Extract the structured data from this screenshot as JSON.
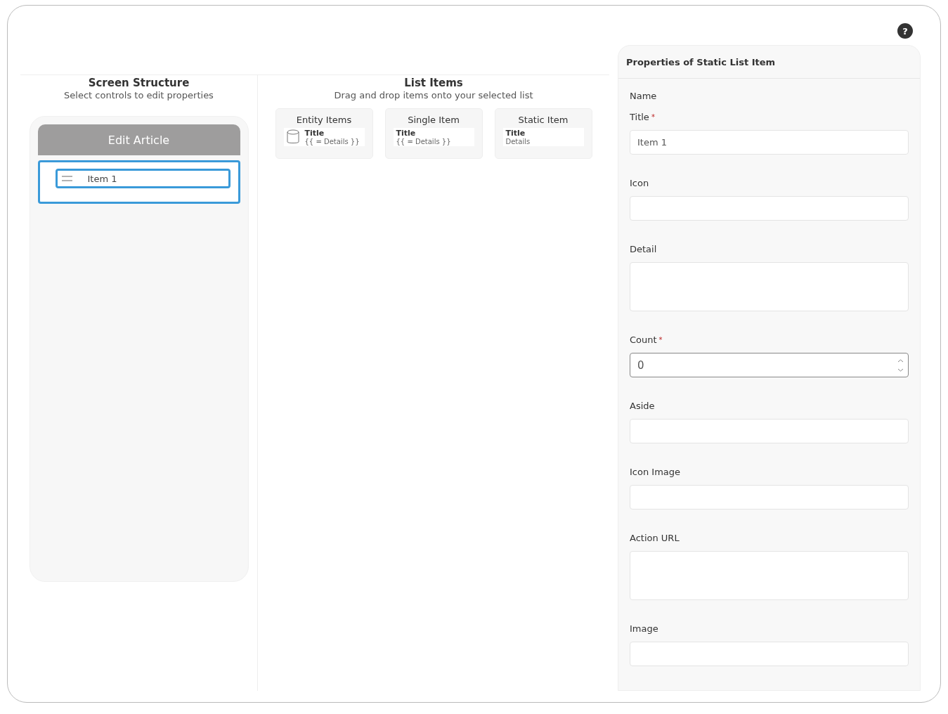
{
  "help": "?",
  "structure": {
    "title": "Screen Structure",
    "subtitle": "Select controls to edit properties",
    "screen_title": "Edit Article",
    "items": [
      {
        "label": "Item 1",
        "selected": true
      }
    ]
  },
  "list_items": {
    "title": "List Items",
    "subtitle": "Drag and drop items onto your selected list",
    "templates": [
      {
        "kind": "entity",
        "name": "Entity Items",
        "title": "Title",
        "details": "{{ = Details }}"
      },
      {
        "kind": "single",
        "name": "Single Item",
        "title": "Title",
        "details": "{{ = Details }}"
      },
      {
        "kind": "static",
        "name": "Static Item",
        "title": "Title",
        "details": "Details"
      }
    ]
  },
  "properties": {
    "title": "Properties of Static List Item",
    "fields": [
      {
        "label": "Name",
        "kind": "none"
      },
      {
        "label": "Title",
        "kind": "text",
        "required_mark": "*",
        "value": "Item 1"
      },
      {
        "label": "Icon",
        "kind": "text"
      },
      {
        "label": "Detail",
        "kind": "textarea"
      },
      {
        "label": "Count",
        "kind": "number",
        "required_mark": "*",
        "value": "0"
      },
      {
        "label": "Aside",
        "kind": "text"
      },
      {
        "label": "Icon Image",
        "kind": "text"
      },
      {
        "label": "Action URL",
        "kind": "textarea"
      },
      {
        "label": "Image",
        "kind": "text"
      }
    ]
  }
}
